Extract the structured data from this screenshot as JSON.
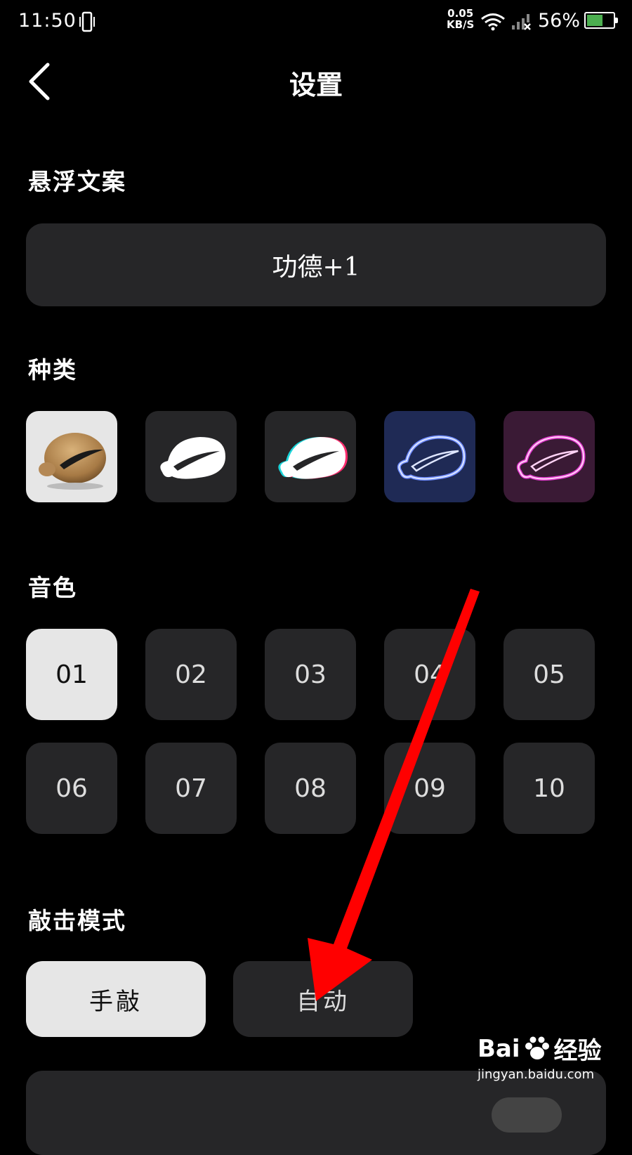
{
  "status_bar": {
    "time": "11:50",
    "net_speed_value": "0.05",
    "net_speed_unit": "KB/S",
    "battery_percent": "56%"
  },
  "header": {
    "title": "设置"
  },
  "floating_text": {
    "section_title": "悬浮文案",
    "value": "功德+1"
  },
  "kind": {
    "section_title": "种类",
    "selected_index": 0
  },
  "tone": {
    "section_title": "音色",
    "options": [
      "01",
      "02",
      "03",
      "04",
      "05",
      "06",
      "07",
      "08",
      "09",
      "10"
    ],
    "selected": "01"
  },
  "tap_mode": {
    "section_title": "敲击模式",
    "manual_label": "手敲",
    "auto_label": "自动",
    "selected": "手敲"
  },
  "watermark": {
    "logo_text_left": "Bai",
    "logo_text_right": "经验",
    "url": "jingyan.baidu.com"
  },
  "colors": {
    "background": "#000000",
    "tile": "#262628",
    "selected": "#e6e6e6",
    "annotation_arrow": "#ff0000"
  }
}
